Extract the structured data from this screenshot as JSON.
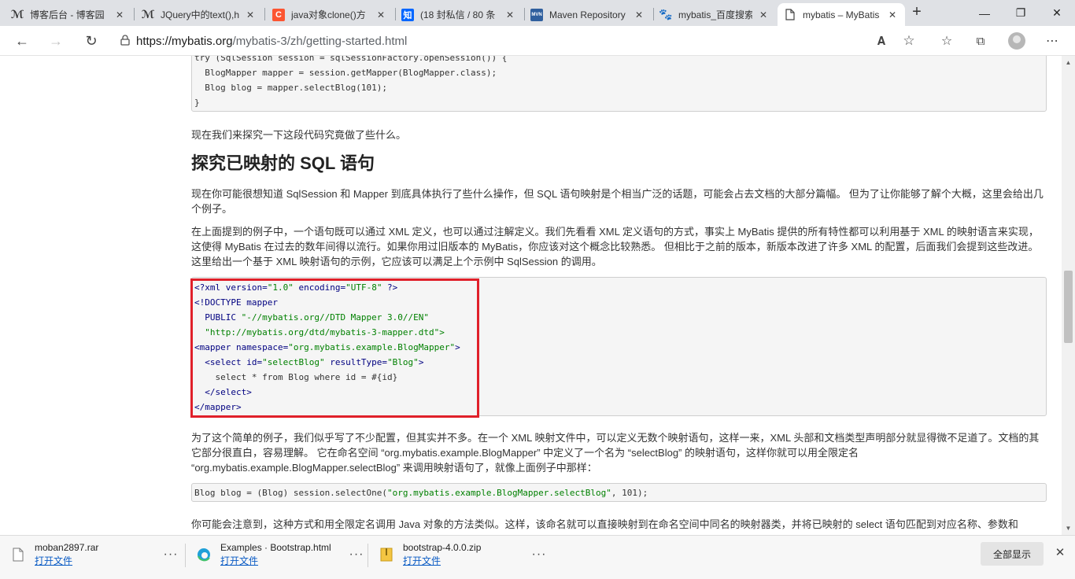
{
  "tabs": [
    {
      "title": "博客后台 - 博客园",
      "icon": "bokeyuan-icon",
      "active": false
    },
    {
      "title": "JQuery中的text(),h",
      "icon": "bokeyuan-icon",
      "active": false
    },
    {
      "title": "java对象clone()方",
      "icon": "csdn-icon",
      "active": false
    },
    {
      "title": "(18 封私信 / 80 条",
      "icon": "zhihu-icon",
      "active": false
    },
    {
      "title": "Maven Repository",
      "icon": "mvn-icon",
      "active": false
    },
    {
      "title": "mybatis_百度搜索",
      "icon": "baidu-icon",
      "active": false
    },
    {
      "title": "mybatis – MyBatis",
      "icon": "page-icon",
      "active": true
    }
  ],
  "address": {
    "host": "https://mybatis.org",
    "path": "/mybatis-3/zh/getting-started.html"
  },
  "content": {
    "top_code": [
      "try (SqlSession session = sqlSessionFactory.openSession()) {",
      "  BlogMapper mapper = session.getMapper(BlogMapper.class);",
      "  Blog blog = mapper.selectBlog(101);",
      "}"
    ],
    "p_explore": "现在我们来探究一下这段代码究竟做了些什么。",
    "heading": "探究已映射的 SQL 语句",
    "p1": "现在你可能很想知道 SqlSession 和 Mapper 到底具体执行了些什么操作，但 SQL 语句映射是个相当广泛的话题，可能会占去文档的大部分篇幅。 但为了让你能够了解个大概，这里会给出几个例子。",
    "p2": "在上面提到的例子中，一个语句既可以通过 XML 定义，也可以通过注解定义。我们先看看 XML 定义语句的方式，事实上 MyBatis 提供的所有特性都可以利用基于 XML 的映射语言来实现，这使得 MyBatis 在过去的数年间得以流行。如果你用过旧版本的 MyBatis，你应该对这个概念比较熟悉。 但相比于之前的版本，新版本改进了许多 XML 的配置，后面我们会提到这些改进。这里给出一个基于 XML 映射语句的示例，它应该可以满足上个示例中 SqlSession 的调用。",
    "xml_code": {
      "l1a": "<?xml version=",
      "l1b": "\"1.0\"",
      "l1c": " encoding=",
      "l1d": "\"UTF-8\"",
      "l1e": " ?>",
      "l2": "<!DOCTYPE mapper",
      "l3a": "  PUBLIC ",
      "l3b": "\"-//mybatis.org//DTD Mapper 3.0//EN\"",
      "l4": "  \"http://mybatis.org/dtd/mybatis-3-mapper.dtd\">",
      "l5a": "<mapper namespace=",
      "l5b": "\"org.mybatis.example.BlogMapper\"",
      "l5c": ">",
      "l6a": "  <select id=",
      "l6b": "\"selectBlog\"",
      "l6c": " resultType=",
      "l6d": "\"Blog\"",
      "l6e": ">",
      "l7": "    select * from Blog where id = #{id}",
      "l8": "  </select>",
      "l9": "</mapper>"
    },
    "p3": "为了这个简单的例子，我们似乎写了不少配置，但其实并不多。在一个 XML 映射文件中，可以定义无数个映射语句，这样一来，XML 头部和文档类型声明部分就显得微不足道了。文档的其它部分很直白，容易理解。 它在命名空间 “org.mybatis.example.BlogMapper” 中定义了一个名为 “selectBlog” 的映射语句，这样你就可以用全限定名 “org.mybatis.example.BlogMapper.selectBlog” 来调用映射语句了，就像上面例子中那样：",
    "one_line_code": {
      "a": "Blog blog = (Blog) session.selectOne(",
      "b": "\"org.mybatis.example.BlogMapper.selectBlog\"",
      "c": ", 101);"
    },
    "p4": "你可能会注意到，这种方式和用全限定名调用 Java 对象的方法类似。这样，该命名就可以直接映射到在命名空间中同名的映射器类，并将已映射的 select 语句匹配到对应名称、参数和"
  },
  "downloads": [
    {
      "name": "moban2897.rar",
      "action": "打开文件",
      "icon": "archive-file-icon"
    },
    {
      "name": "Examples · Bootstrap.html",
      "action": "打开文件",
      "icon": "edge-browser-icon"
    },
    {
      "name": "bootstrap-4.0.0.zip",
      "action": "打开文件",
      "icon": "zip-file-icon"
    }
  ],
  "download_bar": {
    "show_all": "全部显示"
  },
  "colors": {
    "highlight": "#e0202a",
    "link": "#0a5bc4",
    "tabstrip": "#dfe1e5"
  }
}
